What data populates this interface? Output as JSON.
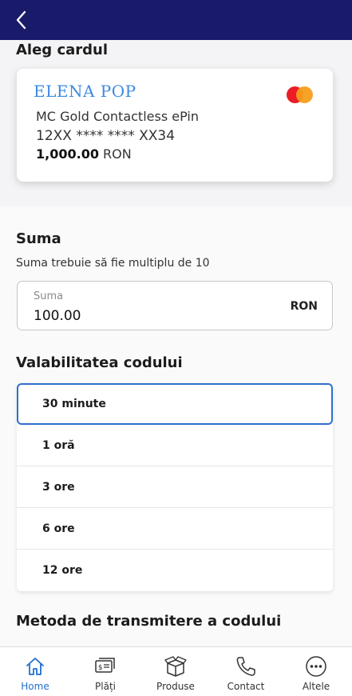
{
  "header": {
    "back_icon": "chevron-left-icon"
  },
  "card_section": {
    "title": "Aleg cardul",
    "card": {
      "holder": "ELENA POP",
      "product": "MC Gold Contactless ePin",
      "number": "12XX **** **** XX34",
      "balance_amount": "1,000.00",
      "balance_currency": "RON",
      "brand_icon": "mastercard-logo-icon"
    }
  },
  "amount_section": {
    "title": "Suma",
    "hint": "Suma trebuie să fie multiplu de 10",
    "field_label": "Suma",
    "field_value": "100.00",
    "currency": "RON"
  },
  "validity_section": {
    "title": "Valabilitatea codului",
    "options": [
      {
        "label": "30 minute",
        "selected": true
      },
      {
        "label": "1 oră",
        "selected": false
      },
      {
        "label": "3 ore",
        "selected": false
      },
      {
        "label": "6 ore",
        "selected": false
      },
      {
        "label": "12 ore",
        "selected": false
      }
    ]
  },
  "method_section": {
    "title": "Metoda de transmitere a codului"
  },
  "tabbar": {
    "items": [
      {
        "label": "Home",
        "icon": "home-icon",
        "active": true
      },
      {
        "label": "Plăți",
        "icon": "payments-icon",
        "active": false
      },
      {
        "label": "Produse",
        "icon": "box-icon",
        "active": false
      },
      {
        "label": "Contact",
        "icon": "phone-icon",
        "active": false
      },
      {
        "label": "Altele",
        "icon": "more-icon",
        "active": false
      }
    ]
  },
  "colors": {
    "header_bg": "#1a1a6b",
    "accent": "#2f6fcd",
    "holder_text": "#3d8ae0"
  }
}
